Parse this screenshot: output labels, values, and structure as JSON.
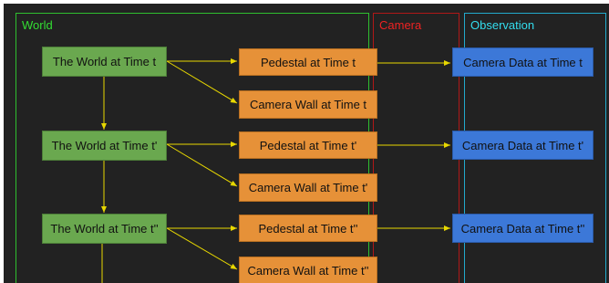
{
  "regions": {
    "world": "World",
    "camera": "Camera",
    "observation": "Observation"
  },
  "colors": {
    "world_node": "#6aa84f",
    "camera_node": "#e69138",
    "observation_node": "#3c78d8",
    "arrow": "#e8d800",
    "world_border": "#2fbf2f",
    "camera_border": "#b01818",
    "observation_border": "#22aacc",
    "background": "#222222"
  },
  "nodes": {
    "world_t": "The World at Time t",
    "world_t1": "The World at Time t'",
    "world_t2": "The World at Time t''",
    "pedestal_t": "Pedestal at Time t",
    "pedestal_t1": "Pedestal at Time t'",
    "pedestal_t2": "Pedestal at Time t''",
    "wall_t": "Camera Wall at Time t",
    "wall_t1": "Camera Wall at Time t'",
    "wall_t2": "Camera Wall at Time t''",
    "data_t": "Camera Data at Time t",
    "data_t1": "Camera Data at Time t'",
    "data_t2": "Camera Data at Time t''"
  }
}
